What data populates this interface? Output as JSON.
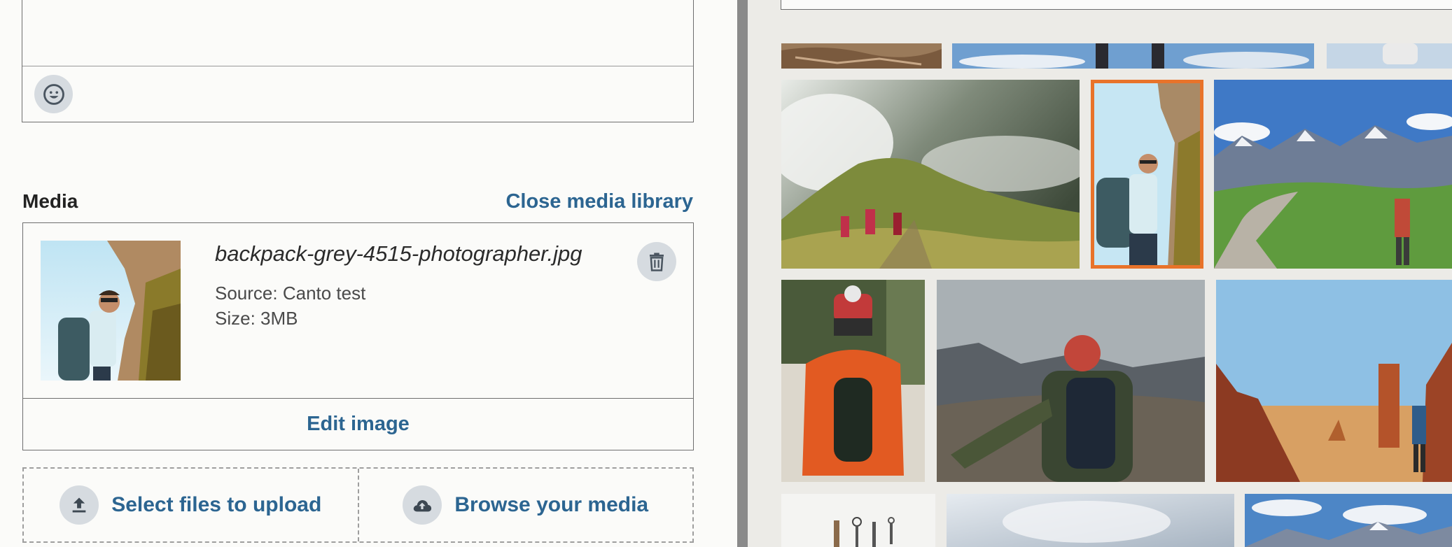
{
  "composer": {
    "emoji_icon": "smiley-face-icon"
  },
  "media": {
    "label": "Media",
    "close_library": "Close media library",
    "file_name": "backpack-grey-4515-photographer.jpg",
    "source_line": "Source: Canto test",
    "size_line": "Size: 3MB",
    "edit_label": "Edit image",
    "delete_icon": "trash-icon"
  },
  "upload": {
    "select_label": "Select files to upload",
    "browse_label": "Browse your media",
    "select_icon": "upload-arrow-icon",
    "browse_icon": "cloud-upload-icon"
  },
  "library": {
    "selected_image": "backpack-grey-4515-photographer.jpg",
    "accent_color": "#e8732a"
  },
  "colors": {
    "link": "#2c6591",
    "icon_bg": "#d6dbe0",
    "panel_bg": "#fbfbf9",
    "library_bg": "#ecebe7"
  }
}
